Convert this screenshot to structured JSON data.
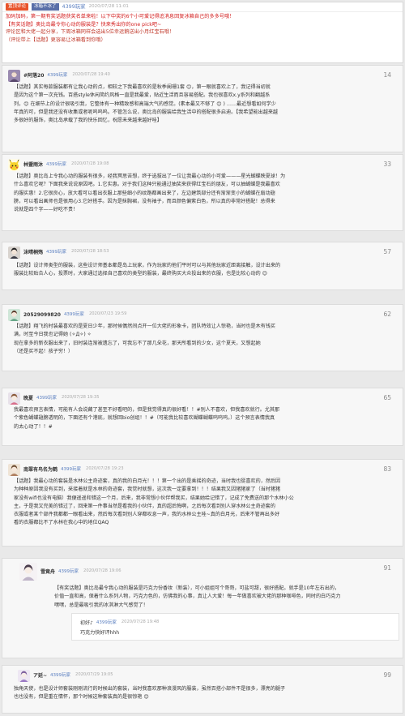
{
  "top_post": {
    "hot_badge": "置顶评论",
    "title": "冰箱不冰了",
    "user": "4399玩家",
    "date": "2020/07/28 11:01",
    "lines": [
      "加码加码，第一期有奖话题获奖名单来啦！以下中奖的6个小可爱记得追消息回复冰箱自己的多多号哦！",
      "【有奖话题】奥比岛最令你心动的服装是？快来秀出你的one pick吧~",
      "评论区和大佬一起分享，下周冰箱同样会选出5位幸运鹅送出小月红宝石哦！",
      "（评论带上【话题】更容易让冰箱看到你哦）"
    ]
  },
  "comments": [
    {
      "name": "#阿落20",
      "badge": "4399玩家",
      "date": "2020/07/28 19:40",
      "floor": "14",
      "lines": [
        "【话题】其实每款服装都有让我心动的点，相较之下我最喜欢的是秋季阑珊1套 😊，第一眼就喜欢上了，我记得当初就",
        "是因为这个第一次充钱。百搭style休闲简约风格一直是我最爱，贴近生活而且容易搭配。我也很喜欢x.y系列和翻越系",
        "列，😊 在细节上的设计很吸引我，它整体有一种精致感和高端大气的感觉。(素本最又不够了 😊 ) ……最近想看如何学少",
        "年真的可，但是我还没有收集或者呢呜呜呜。不管怎么说，奥比岛的服装给我生活中的搭配很多启迪。【我希望能出越来越",
        "多很好的服饰，奥比岛承载了我的快乐回忆，祝愿未来越来越好哇】"
      ]
    },
    {
      "name": "林暨雨沐",
      "badge": "4399玩家",
      "date": "2020/07/28 19:08",
      "floor": "33",
      "lines": [
        "【话题】奥比岛上令我心动的服装有很多，经我冥思苦想，终于选拔出了一位让我最心动的小可爱———星光蝴蝶映夏球！为",
        "什么喜欢它呢？下面我来说说原因吧。1.它实惠。对于我们这种只能通过抽奖来获得红宝石的朋友，可以抽蝴蝶是我最喜欢",
        "的服实惠！2.它很良心，放大看可以看出衣服上那些细小的纹路都画出来了，左边建筑部分还有渐渐变小的蝴蝶在扇动翅",
        "膀，可以看出画师也是很用心3.它好搭手。因为是抹胸裙，没有袖子，而且颜色偏紫白色，所以真的非常好搭配！总得来",
        "说就是四个字——好吃不贵！"
      ]
    },
    {
      "name": "沫晴桐殇",
      "badge": "4399玩家",
      "date": "2020/07/28 18:53",
      "floor": "57",
      "lines": [
        "【话题】设计师类型的服装，这些设计师基本都是岛上玩家，作为玩家的他们平时可以与其他玩家近距离接触，设计出来的",
        "服装比较贴合人心，投票时，大家通过选择自己喜欢的类型的服装，最终购买大众投出来的衣服，也是比较心动的 😊"
      ]
    },
    {
      "name": "20529099820",
      "badge": "4399玩家",
      "date": "2020/07/23 19:59",
      "floor": "62",
      "lines": [
        "【话题】翔飞的时装最喜欢的是夏日少年，那时候偶然间点开一位大佬的形象卡，团队特效让人惊艳，当时也是木有钱买",
        "满，时至今日我也记得她 (✧Д✧) ✧",
        "现在拿多的新衣服出来了，旧时装连渐被遗忘了，可我忘不了那几朵花，那天所看到的少女，这个夏天，又想起她",
        "（还是买不起！孩子穷！）"
      ]
    },
    {
      "name": "晚夏",
      "badge": "4399玩家",
      "date": "2020/07/28 19:35",
      "floor": "65",
      "lines": [
        "我最喜欢预言表情，可能有人会说藏了甚至不好看吧的，但是我觉得真的很好看！！#别人不喜欢，但我喜欢就行。尤其那",
        "个紫色蝴蝶翅膀透明的，下面还有个港底，就想回bio创组！！#（可能我比较喜欢蝴蝶蝴蝶呜呜呜。）这个预言表情我真",
        "的太心动了！！#"
      ]
    },
    {
      "name": "南翠有鸟名为鹤",
      "badge": "4399玩家",
      "date": "2020/07/28 19:23",
      "floor": "83",
      "lines": [
        "【话题】我最心动的套装是水林公主奇迹套，真的我的白月光！！！第一个出的是乘摇的奇迹，当时我也挺喜欢的，然后因",
        "为种种原因我没有买到，采接着就是水林的奇迹套，我觉时就想，这次我一定要拿到！！！结果我又因猪猪家了（当时猪猪",
        "家没有wifi也没有电脑）我便遥遥和错这一个月，后来，我非常想小伙伴帮我买，结果她给记错了，记成了免费送的那个水林小公",
        "主，于是我又完美的错过了，回来第一件事当然是看我的小伙伴，真的超后悔啊，之后每次看到别人穿水林公主奇迹套的",
        "衣服或者某个部件我都都一眼看出来，然后每次看到别人穿都叹息一声，我的水林公主哇~真的白月光，后来不管再出多好",
        "看的衣服都比不了水林在我心中的地位QAQ"
      ]
    },
    {
      "name": "雪竟舟",
      "badge": "4399玩家",
      "date": "2020/07/28 19:06",
      "floor": "91",
      "lines": [
        "【有奖话题】奥比岛最令我心动的服装是巧克力份香妆（新装），可小姐姐可个哥哥，可盐可甜，很好搭配。就手是10年左右出的，",
        "价值一直和高，保着什么系列人物，巧克力色的，仿佛我的心事，真让人大爱！每一年做喜欢被大佬的那种咖啡色，同时的白巧克力",
        "嘿嘿，总是最吸引我的冰淇淋大气感觉了！"
      ],
      "reply": {
        "name": "初好♪",
        "badge": "4399玩家",
        "date": "2020/07/28 19:48",
        "text": "巧克力快好评hhh"
      }
    },
    {
      "name": "ア延~",
      "badge": "4399玩家",
      "date": "2020/07/29 19:05",
      "floor": "99",
      "lines": [
        "独角天使，也是设计师套装刚刚流行的时候出的套装，当时我喜欢那种浪漫风的服装，虽然百搭小部件不是很多，漂亮的腿子",
        "也也没有，但是重在情怀，那个时候这种套装真的是很惊艳 😊"
      ]
    }
  ]
}
